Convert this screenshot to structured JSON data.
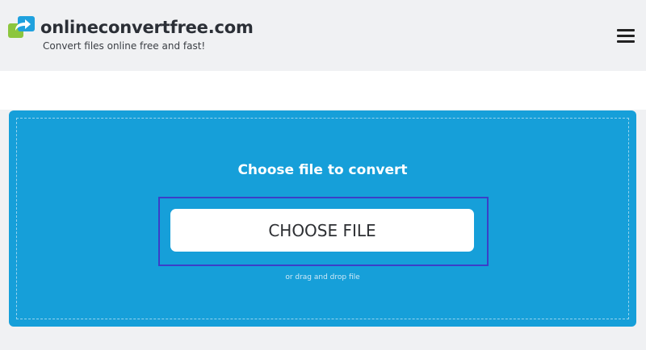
{
  "header": {
    "brand_name": "onlineconvertfree.com",
    "tagline": "Convert files online free and fast!",
    "logo_icon": "convert-arrow-logo",
    "menu_icon": "hamburger-menu-icon"
  },
  "upload": {
    "title": "Choose file to convert",
    "button_label": "CHOOSE FILE",
    "drop_hint": "or drag and drop file"
  },
  "colors": {
    "panel_blue": "#169fd9",
    "focus_outline": "#3b3fc8",
    "page_bg": "#f0f1f3",
    "logo_green": "#8cc63e",
    "logo_blue": "#1fa1de"
  }
}
